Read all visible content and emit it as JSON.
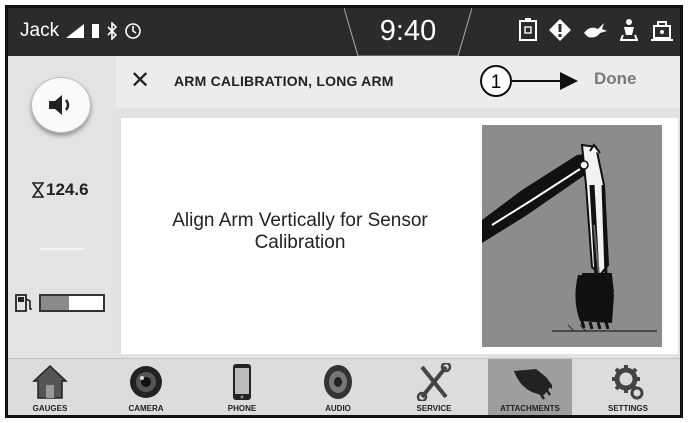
{
  "status_bar": {
    "user": "Jack",
    "time": "9:40"
  },
  "rail": {
    "hours": "124.6",
    "fuel_level": 0.45
  },
  "header": {
    "title": "ARM CALIBRATION, LONG ARM",
    "callout": "1",
    "done_label": "Done"
  },
  "content": {
    "instruction": "Align Arm Vertically for Sensor Calibration"
  },
  "nav": [
    {
      "label": "GAUGES",
      "icon": "house-icon"
    },
    {
      "label": "CAMERA",
      "icon": "camera-icon"
    },
    {
      "label": "PHONE",
      "icon": "phone-icon"
    },
    {
      "label": "AUDIO",
      "icon": "speaker-icon"
    },
    {
      "label": "SERVICE",
      "icon": "tools-icon"
    },
    {
      "label": "ATTACHMENTS",
      "icon": "bucket-icon",
      "active": true
    },
    {
      "label": "SETTINGS",
      "icon": "gear-icon"
    }
  ]
}
